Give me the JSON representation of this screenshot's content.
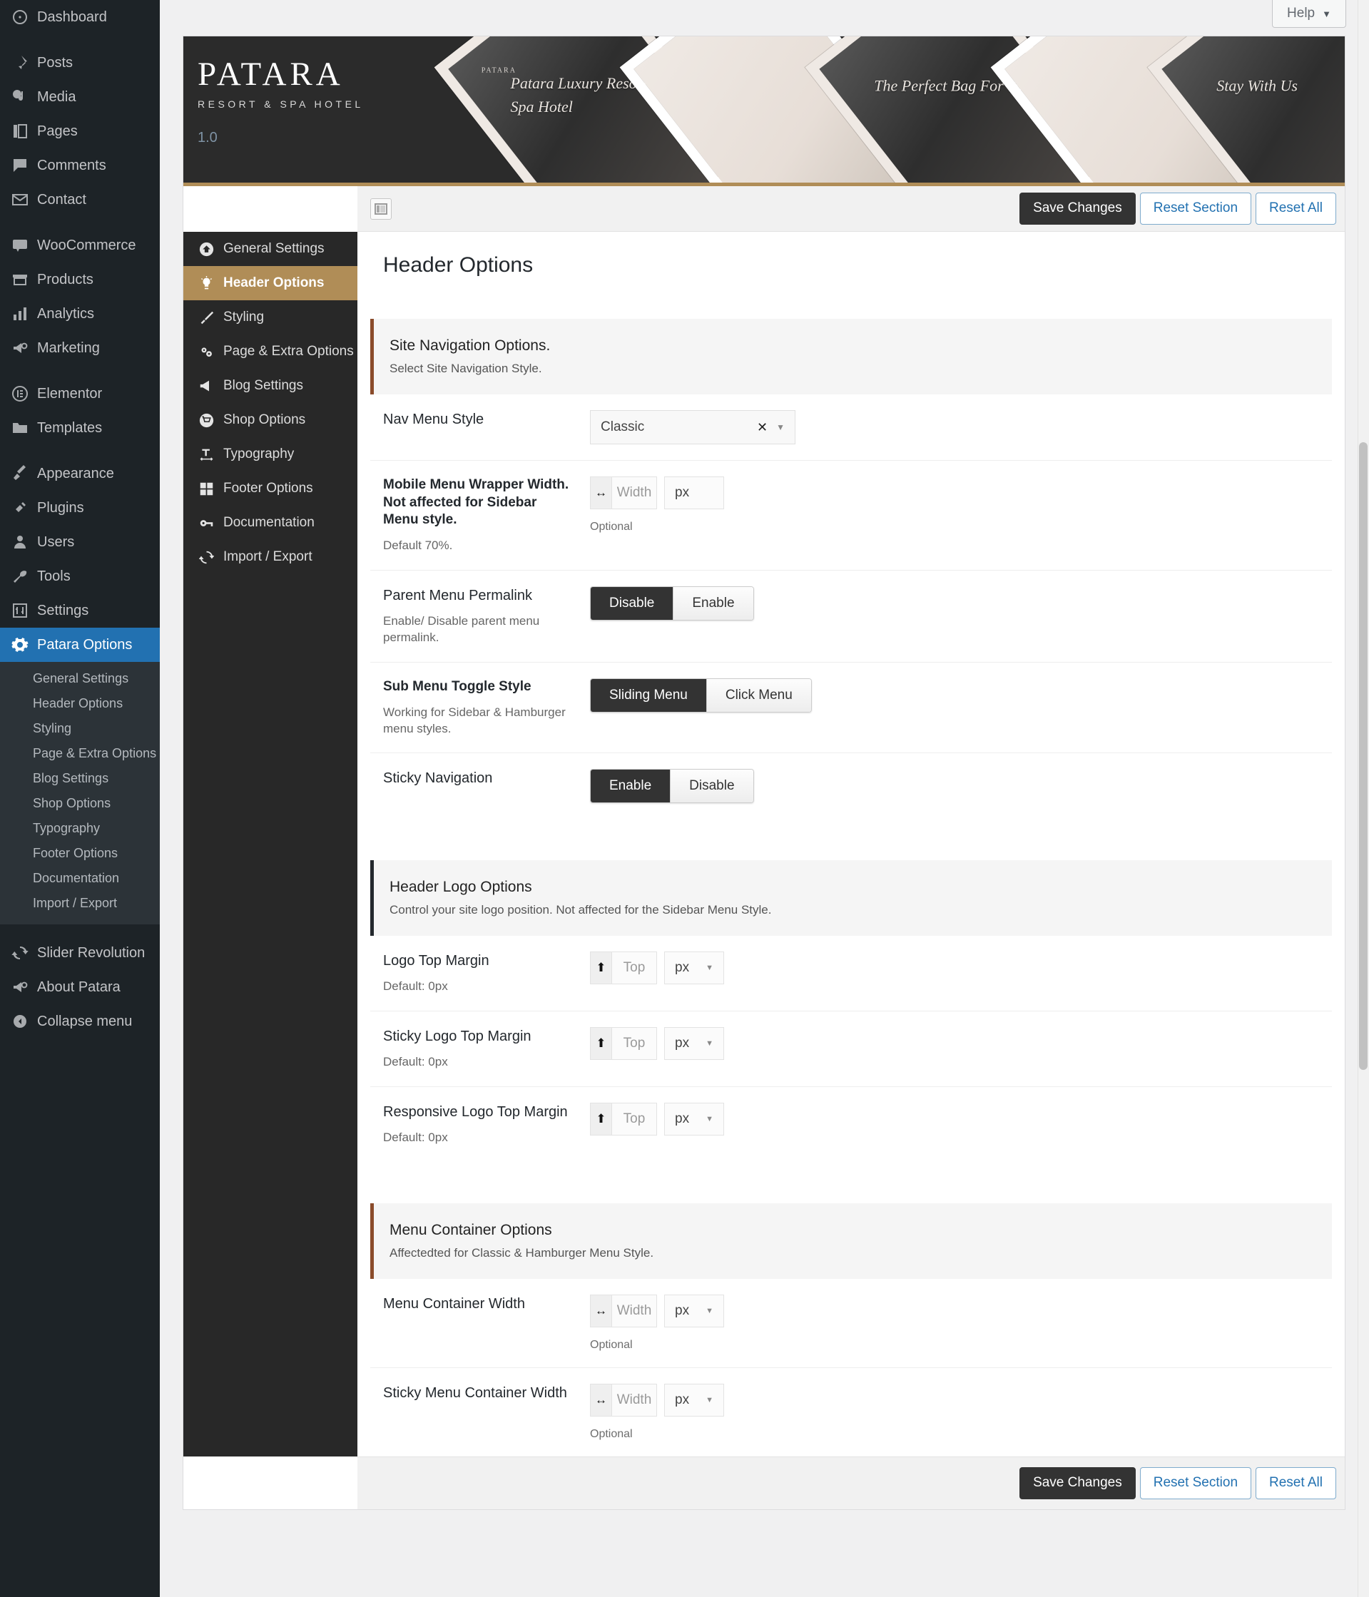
{
  "wp_sidebar": {
    "items": [
      {
        "label": "Dashboard",
        "icon": "dashboard-icon",
        "gap_after": true
      },
      {
        "label": "Posts",
        "icon": "pin-icon"
      },
      {
        "label": "Media",
        "icon": "media-icon"
      },
      {
        "label": "Pages",
        "icon": "pages-icon"
      },
      {
        "label": "Comments",
        "icon": "comments-icon"
      },
      {
        "label": "Contact",
        "icon": "mail-icon",
        "gap_after": true
      },
      {
        "label": "WooCommerce",
        "icon": "woo-icon"
      },
      {
        "label": "Products",
        "icon": "products-icon"
      },
      {
        "label": "Analytics",
        "icon": "analytics-icon"
      },
      {
        "label": "Marketing",
        "icon": "megaphone-icon",
        "gap_after": true
      },
      {
        "label": "Elementor",
        "icon": "elementor-icon"
      },
      {
        "label": "Templates",
        "icon": "folder-icon",
        "gap_after": true
      },
      {
        "label": "Appearance",
        "icon": "brush-icon"
      },
      {
        "label": "Plugins",
        "icon": "plug-icon"
      },
      {
        "label": "Users",
        "icon": "user-icon"
      },
      {
        "label": "Tools",
        "icon": "wrench-icon"
      },
      {
        "label": "Settings",
        "icon": "sliders-icon"
      }
    ],
    "active_item": {
      "label": "Patara Options",
      "icon": "gear-icon"
    },
    "submenu": [
      "General Settings",
      "Header Options",
      "Styling",
      "Page & Extra Options",
      "Blog Settings",
      "Shop Options",
      "Typography",
      "Footer Options",
      "Documentation",
      "Import / Export"
    ],
    "bottom_items": [
      {
        "label": "Slider Revolution",
        "icon": "refresh-icon"
      },
      {
        "label": "About Patara",
        "icon": "megaphone-icon"
      },
      {
        "label": "Collapse menu",
        "icon": "collapse-icon"
      }
    ],
    "active_color": "#2271b1"
  },
  "help": {
    "label": "Help",
    "caret": "▼"
  },
  "banner": {
    "brand": "PATARA",
    "subtitle": "RESORT & SPA HOTEL",
    "version": "1.0",
    "accent_color": "#b08d57",
    "shard_texts": [
      "Patara Luxury Resort Spa Hotel",
      "The Perfect Bag For You",
      "Stay With Us"
    ],
    "shard_mini": "PATARA"
  },
  "toolbar": {
    "expand_icon": "layout-toggle-icon",
    "save_label": "Save Changes",
    "reset_section_label": "Reset Section",
    "reset_all_label": "Reset All"
  },
  "panel_nav": {
    "items": [
      {
        "label": "General Settings",
        "icon": "home-icon",
        "active": false
      },
      {
        "label": "Header Options",
        "icon": "bulb-icon",
        "active": true
      },
      {
        "label": "Styling",
        "icon": "brush-icon",
        "active": false
      },
      {
        "label": "Page & Extra Options",
        "icon": "cogs-icon",
        "active": false
      },
      {
        "label": "Blog Settings",
        "icon": "megaphone-icon",
        "active": false
      },
      {
        "label": "Shop Options",
        "icon": "cart-icon",
        "active": false
      },
      {
        "label": "Typography",
        "icon": "typography-icon",
        "active": false
      },
      {
        "label": "Footer Options",
        "icon": "grid-icon",
        "active": false
      },
      {
        "label": "Documentation",
        "icon": "key-icon",
        "active": false
      },
      {
        "label": "Import / Export",
        "icon": "sync-icon",
        "active": false
      }
    ],
    "active_color": "#b08d57"
  },
  "page": {
    "title": "Header Options"
  },
  "sections": [
    {
      "title": "Site Navigation Options.",
      "desc": "Select Site Navigation Style.",
      "border": "#8a4b2a"
    },
    {
      "title": "Header Logo Options",
      "desc": "Control your site logo position. Not affected for the Sidebar Menu Style.",
      "border": "#23282d"
    },
    {
      "title": "Menu Container Options",
      "desc": "Affectedted for Classic & Hamburger Menu Style.",
      "border": "#8a4b2a"
    }
  ],
  "fields": {
    "nav_menu_style": {
      "label": "Nav Menu Style",
      "value": "Classic",
      "clear": "✕",
      "caret": "▼"
    },
    "mobile_menu_width": {
      "label": "Mobile Menu Wrapper Width. Not affected for Sidebar Menu style.",
      "desc": "Default 70%.",
      "icon": "↔",
      "placeholder": "Width",
      "unit": "px",
      "optional": "Optional"
    },
    "parent_menu_permalink": {
      "label": "Parent Menu Permalink",
      "desc": "Enable/ Disable parent menu permalink.",
      "options": [
        "Disable",
        "Enable"
      ],
      "selected": "Disable"
    },
    "sub_menu_toggle_style": {
      "label": "Sub Menu Toggle Style",
      "desc": "Working for Sidebar & Hamburger menu styles.",
      "options": [
        "Sliding Menu",
        "Click Menu"
      ],
      "selected": "Sliding Menu"
    },
    "sticky_navigation": {
      "label": "Sticky Navigation",
      "options": [
        "Enable",
        "Disable"
      ],
      "selected": "Enable"
    },
    "logo_top_margin": {
      "label": "Logo Top Margin",
      "desc": "Default: 0px",
      "icon": "⬆",
      "placeholder": "Top",
      "unit": "px",
      "caret": "▼"
    },
    "sticky_logo_top_margin": {
      "label": "Sticky Logo Top Margin",
      "desc": "Default: 0px",
      "icon": "⬆",
      "placeholder": "Top",
      "unit": "px",
      "caret": "▼"
    },
    "responsive_logo_top_margin": {
      "label": "Responsive Logo Top Margin",
      "desc": "Default: 0px",
      "icon": "⬆",
      "placeholder": "Top",
      "unit": "px",
      "caret": "▼"
    },
    "menu_container_width": {
      "label": "Menu Container Width",
      "icon": "↔",
      "placeholder": "Width",
      "unit": "px",
      "caret": "▼",
      "optional": "Optional"
    },
    "sticky_menu_container_width": {
      "label": "Sticky Menu Container Width",
      "icon": "↔",
      "placeholder": "Width",
      "unit": "px",
      "caret": "▼",
      "optional": "Optional"
    }
  }
}
